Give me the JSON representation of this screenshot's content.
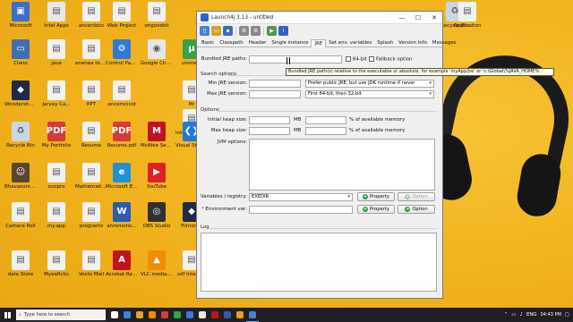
{
  "desktop": {
    "icons": [
      {
        "label": "Microsoft",
        "color": "#3b6fc9",
        "glyph": "▣"
      },
      {
        "label": "Intel Apps",
        "color": "#e8e8e8",
        "glyph": "▤"
      },
      {
        "label": "ancerdocs",
        "color": "#f1f1f1",
        "glyph": "▤"
      },
      {
        "label": "Web Project",
        "color": "#f1f1f1",
        "glyph": "▤"
      },
      {
        "label": "ongoodsit",
        "color": "#f1f1f1",
        "glyph": "▤"
      },
      {
        "label": "Ciano",
        "color": "#3f6fb2",
        "glyph": "▭"
      },
      {
        "label": "java",
        "color": "#f1f1f1",
        "glyph": "▤"
      },
      {
        "label": "anenea templates",
        "color": "#f1f1f1",
        "glyph": "▤"
      },
      {
        "label": "Control Panel",
        "color": "#2e7bd6",
        "glyph": "⚙"
      },
      {
        "label": "Google Chrome",
        "color": "#e6e6e6",
        "glyph": "◉"
      },
      {
        "label": "utorrent",
        "color": "#3aa04a",
        "glyph": "µ"
      },
      {
        "label": "Wondershare Filmora 9",
        "color": "#1d2a4a",
        "glyph": "◆"
      },
      {
        "label": "Jarvey Ca...",
        "color": "#f1f1f1",
        "glyph": "▤"
      },
      {
        "label": "PPT",
        "color": "#f1f1f1",
        "glyph": "▤"
      },
      {
        "label": "ancemcicid",
        "color": "#f1f1f1",
        "glyph": "▤"
      },
      {
        "label": "Mr",
        "color": "#f1f1f1",
        "glyph": "▤"
      },
      {
        "label": "Interview Questions",
        "color": "#f1f1f1",
        "glyph": "▤"
      },
      {
        "label": "Recycle Bin",
        "color": "#c9d6e4",
        "glyph": "♻"
      },
      {
        "label": "My Portfolio",
        "color": "#d63b3b",
        "glyph": "PDF"
      },
      {
        "label": "Resume",
        "color": "#f1f1f1",
        "glyph": "▤"
      },
      {
        "label": "Resume.pdf",
        "color": "#d63b3b",
        "glyph": "PDF"
      },
      {
        "label": "McAfee Security Scan",
        "color": "#c1121f",
        "glyph": "M"
      },
      {
        "label": "Visual Studio Code",
        "color": "#1f7ad6",
        "glyph": "❮❯"
      },
      {
        "label": "Bhavasonic Kumar",
        "color": "#5a4630",
        "glyph": "☺"
      },
      {
        "label": "ovopro",
        "color": "#f1f1f1",
        "glyph": "▤"
      },
      {
        "label": "Mathematic Operations",
        "color": "#f1f1f1",
        "glyph": "▤"
      },
      {
        "label": "Microsoft Edge",
        "color": "#1f8fd6",
        "glyph": "e"
      },
      {
        "label": "YouTube",
        "color": "#e02020",
        "glyph": "▶"
      },
      {
        "label": "Camera Roll",
        "color": "#f1f1f1",
        "glyph": "▤"
      },
      {
        "label": "my.app",
        "color": "#f1f1f1",
        "glyph": "▤"
      },
      {
        "label": "programs",
        "color": "#f1f1f1",
        "glyph": "▤"
      },
      {
        "label": "ahremotio...",
        "color": "#2b5cad",
        "glyph": "W"
      },
      {
        "label": "OBS Studio",
        "color": "#303030",
        "glyph": "◎"
      },
      {
        "label": "Filmora9",
        "color": "#1d2a4a",
        "glyph": "◆"
      },
      {
        "label": "data Store",
        "color": "#f1f1f1",
        "glyph": "▤"
      },
      {
        "label": "MyeaRcks",
        "color": "#f1f1f1",
        "glyph": "▤"
      },
      {
        "label": "Vecto Mail",
        "color": "#f1f1f1",
        "glyph": "▤"
      },
      {
        "label": "Acrobat Reader DC",
        "color": "#c1121f",
        "glyph": "A"
      },
      {
        "label": "VLC media player",
        "color": "#f28c00",
        "glyph": "▲"
      },
      {
        "label": "sdf Internet",
        "color": "#f1f1f1",
        "glyph": "▤"
      },
      {
        "label": "Recycle Bin",
        "color": "#c9d6e4",
        "glyph": "♻"
      },
      {
        "label": "Application",
        "color": "#f1f1f1",
        "glyph": "▤"
      }
    ]
  },
  "window": {
    "title": "Launch4j 3.13 - untitled",
    "minimize": "—",
    "maximize": "☐",
    "close": "✕"
  },
  "toolbar": {
    "buttons": [
      {
        "name": "new",
        "color": "#4a7fd4",
        "glyph": "▯"
      },
      {
        "name": "open",
        "color": "#d9a227",
        "glyph": "▭"
      },
      {
        "name": "save",
        "color": "#3b6bbf",
        "glyph": "▪"
      },
      {
        "name": "settings",
        "color": "#8a8a8a",
        "glyph": "⚙"
      },
      {
        "name": "build",
        "color": "#888888",
        "glyph": "⚙"
      },
      {
        "name": "run",
        "color": "#4d9a4d",
        "glyph": "▶"
      },
      {
        "name": "about",
        "color": "#2a63c4",
        "glyph": "i"
      }
    ]
  },
  "tabs": [
    "Basic",
    "Classpath",
    "Header",
    "Single instance",
    "JRE",
    "Set env. variables",
    "Splash",
    "Version Info",
    "Messages"
  ],
  "active_tab": "JRE",
  "jre": {
    "bundled_label": "Bundled JRE paths:",
    "bundled_value": "",
    "bit64_label": "64-bit",
    "fallback_label": "Fallback option",
    "search_group": "Search options",
    "min_label": "Min JRE version:",
    "min_value": "",
    "max_label": "Max JRE version:",
    "max_value": "",
    "jdk_pref": "Prefer public JRE, but use JDK runtime if never",
    "arch_pref": "First 64-bit, then 32-bit",
    "options_group": "Options",
    "initial_heap_label": "Initial heap size:",
    "max_heap_label": "Max heap size:",
    "mb": "MB",
    "pct_label": "% of available memory",
    "jvm_label": "JVM options:",
    "vars_label": "Variables / registry:",
    "vars_value": "EXEDIR",
    "property_btn": "Property",
    "option_btn": "Option",
    "env_label": "Environment var:",
    "env_required": "*",
    "log_label": "Log"
  },
  "tooltip": "Bundled JRE path(s) relative to the executable or absolute, for example 'myApp/jre' or 'c:\\Global\\%JAVA_HOME%'.",
  "taskbar": {
    "search_placeholder": "Type here to search",
    "apps": [
      {
        "color": "#ffffff"
      },
      {
        "color": "#3b84e0"
      },
      {
        "color": "#e8a320"
      },
      {
        "color": "#ff8a00"
      },
      {
        "color": "#d53b3b"
      },
      {
        "color": "#28a745"
      },
      {
        "color": "#3a79d8"
      },
      {
        "color": "#e8e8e8"
      },
      {
        "color": "#c1121f"
      },
      {
        "color": "#2b5cad"
      },
      {
        "color": "#f0a020"
      },
      {
        "color": "#4a7fd4"
      }
    ],
    "lang": "ENG",
    "time": "04:43 PM",
    "date": ""
  }
}
